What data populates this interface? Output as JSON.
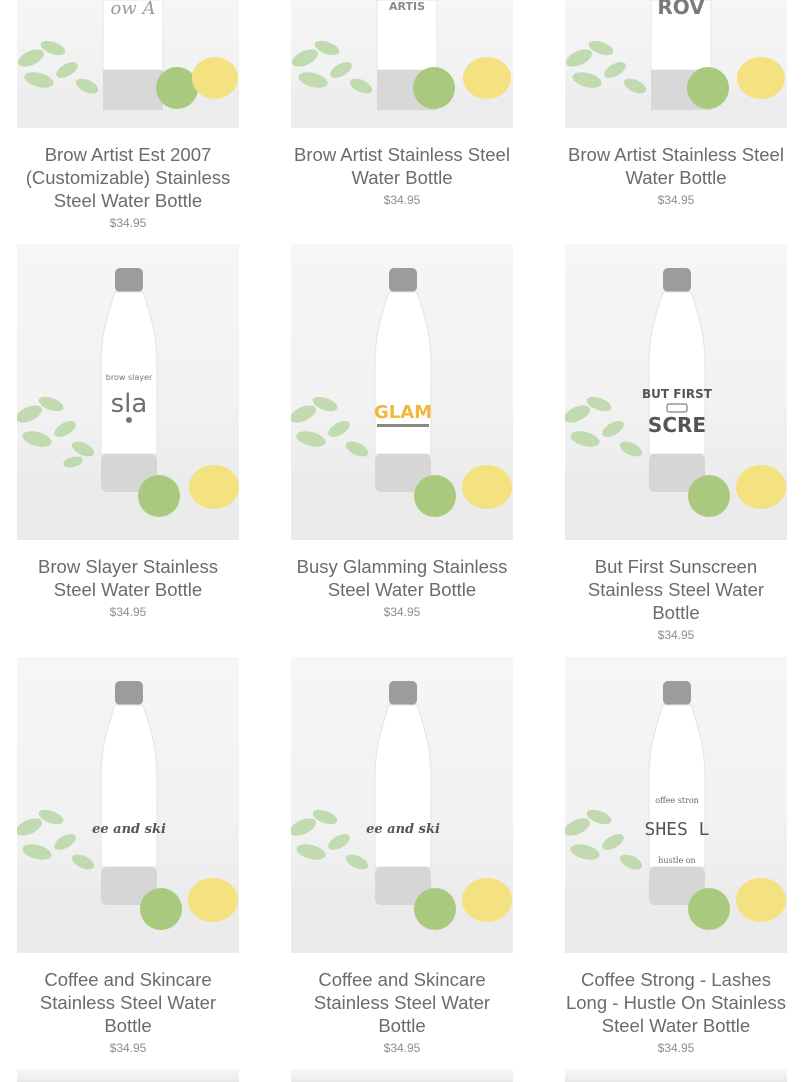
{
  "products": [
    {
      "title": "Brow Artist Est 2007 (Customizable) Stainless Steel Water Bottle",
      "price": "$34.95",
      "design": "BROW ARTIST"
    },
    {
      "title": "Brow Artist Stainless Steel Water Bottle",
      "price": "$34.95",
      "design": "ARTIST"
    },
    {
      "title": "Brow Artist Stainless Steel Water Bottle",
      "price": "$34.95",
      "design": "BROW"
    },
    {
      "title": "Brow Slayer Stainless Steel Water Bottle",
      "price": "$34.95",
      "design": "brow slayer"
    },
    {
      "title": "Busy Glamming Stainless Steel Water Bottle",
      "price": "$34.95",
      "design": "GLAMMI"
    },
    {
      "title": "But First Sunscreen Stainless Steel Water Bottle",
      "price": "$34.95",
      "design": "BUT FIRST SUNSCREEN"
    },
    {
      "title": "Coffee and Skincare Stainless Steel Water Bottle",
      "price": "$34.95",
      "design": "coffee and skincare"
    },
    {
      "title": "Coffee and Skincare Stainless Steel Water Bottle",
      "price": "$34.95",
      "design": "coffee and skincare"
    },
    {
      "title": "Coffee Strong - Lashes Long - Hustle On Stainless Steel Water Bottle",
      "price": "$34.95",
      "design": "COFFEE STRONG LASHES LONG HUSTLE ON"
    }
  ],
  "colors": {
    "title": "#6b6b6b",
    "price": "#8d8d8d",
    "glam_accent": "#f2b63a"
  }
}
